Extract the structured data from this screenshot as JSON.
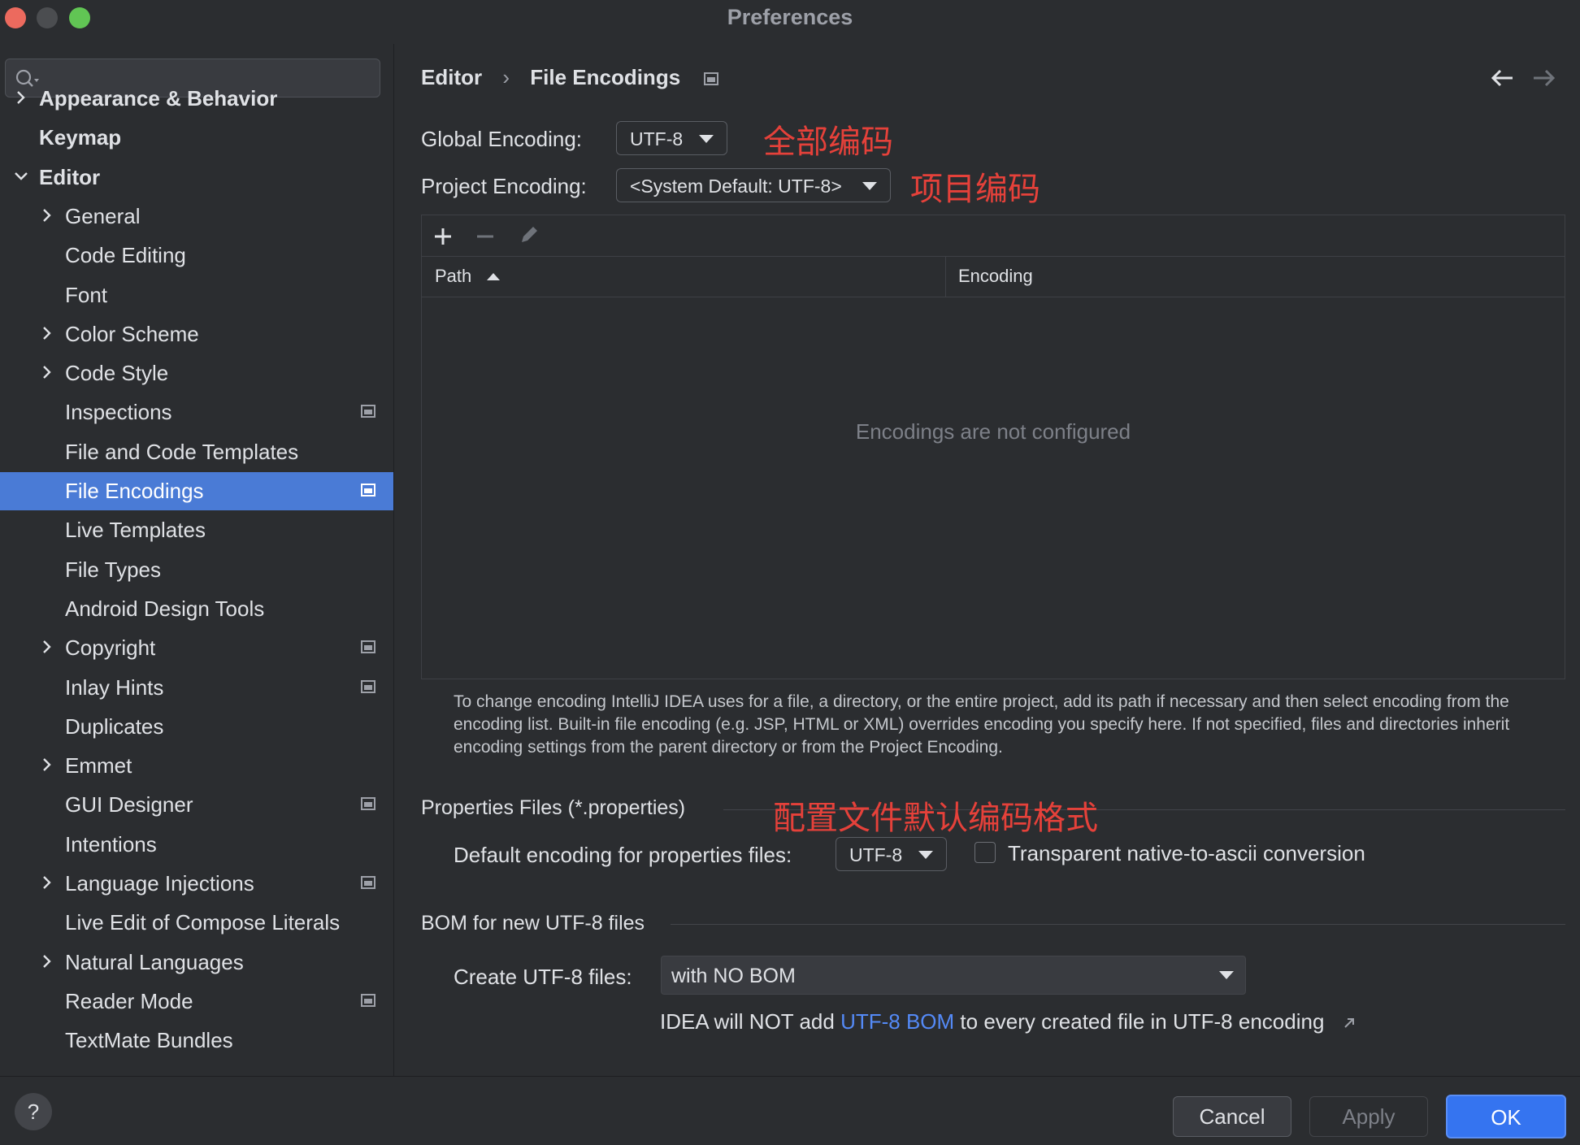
{
  "window": {
    "title": "Preferences",
    "traffic_colors": {
      "close": "#ec6a5e",
      "minimize": "#4b4d50",
      "maximize": "#61c554"
    }
  },
  "sidebar": {
    "search_placeholder": "",
    "items": [
      {
        "label": "Appearance & Behavior",
        "level": 0,
        "chevron": "right",
        "bold": true,
        "project_icon": false,
        "selected": false
      },
      {
        "label": "Keymap",
        "level": 0,
        "chevron": "none",
        "bold": true,
        "project_icon": false,
        "selected": false
      },
      {
        "label": "Editor",
        "level": 0,
        "chevron": "down",
        "bold": true,
        "project_icon": false,
        "selected": false
      },
      {
        "label": "General",
        "level": 1,
        "chevron": "right",
        "bold": false,
        "project_icon": false,
        "selected": false
      },
      {
        "label": "Code Editing",
        "level": 1,
        "chevron": "none",
        "bold": false,
        "project_icon": false,
        "selected": false
      },
      {
        "label": "Font",
        "level": 1,
        "chevron": "none",
        "bold": false,
        "project_icon": false,
        "selected": false
      },
      {
        "label": "Color Scheme",
        "level": 1,
        "chevron": "right",
        "bold": false,
        "project_icon": false,
        "selected": false
      },
      {
        "label": "Code Style",
        "level": 1,
        "chevron": "right",
        "bold": false,
        "project_icon": false,
        "selected": false
      },
      {
        "label": "Inspections",
        "level": 1,
        "chevron": "none",
        "bold": false,
        "project_icon": true,
        "selected": false
      },
      {
        "label": "File and Code Templates",
        "level": 1,
        "chevron": "none",
        "bold": false,
        "project_icon": false,
        "selected": false
      },
      {
        "label": "File Encodings",
        "level": 1,
        "chevron": "none",
        "bold": false,
        "project_icon": true,
        "selected": true
      },
      {
        "label": "Live Templates",
        "level": 1,
        "chevron": "none",
        "bold": false,
        "project_icon": false,
        "selected": false
      },
      {
        "label": "File Types",
        "level": 1,
        "chevron": "none",
        "bold": false,
        "project_icon": false,
        "selected": false
      },
      {
        "label": "Android Design Tools",
        "level": 1,
        "chevron": "none",
        "bold": false,
        "project_icon": false,
        "selected": false
      },
      {
        "label": "Copyright",
        "level": 1,
        "chevron": "right",
        "bold": false,
        "project_icon": true,
        "selected": false
      },
      {
        "label": "Inlay Hints",
        "level": 1,
        "chevron": "none",
        "bold": false,
        "project_icon": true,
        "selected": false
      },
      {
        "label": "Duplicates",
        "level": 1,
        "chevron": "none",
        "bold": false,
        "project_icon": false,
        "selected": false
      },
      {
        "label": "Emmet",
        "level": 1,
        "chevron": "right",
        "bold": false,
        "project_icon": false,
        "selected": false
      },
      {
        "label": "GUI Designer",
        "level": 1,
        "chevron": "none",
        "bold": false,
        "project_icon": true,
        "selected": false
      },
      {
        "label": "Intentions",
        "level": 1,
        "chevron": "none",
        "bold": false,
        "project_icon": false,
        "selected": false
      },
      {
        "label": "Language Injections",
        "level": 1,
        "chevron": "right",
        "bold": false,
        "project_icon": true,
        "selected": false
      },
      {
        "label": "Live Edit of Compose Literals",
        "level": 1,
        "chevron": "none",
        "bold": false,
        "project_icon": false,
        "selected": false
      },
      {
        "label": "Natural Languages",
        "level": 1,
        "chevron": "right",
        "bold": false,
        "project_icon": false,
        "selected": false
      },
      {
        "label": "Reader Mode",
        "level": 1,
        "chevron": "none",
        "bold": false,
        "project_icon": true,
        "selected": false
      },
      {
        "label": "TextMate Bundles",
        "level": 1,
        "chevron": "none",
        "bold": false,
        "project_icon": false,
        "selected": false
      }
    ]
  },
  "content": {
    "breadcrumb": {
      "parent": "Editor",
      "separator": "›",
      "current": "File Encodings"
    },
    "global_encoding": {
      "label": "Global Encoding:",
      "value": "UTF-8",
      "annotation": "全部编码"
    },
    "project_encoding": {
      "label": "Project Encoding:",
      "value": "<System Default: UTF-8>",
      "annotation": "项目编码"
    },
    "table": {
      "toolbar": [
        "add-icon",
        "remove-icon",
        "edit-icon"
      ],
      "columns": [
        "Path",
        "Encoding"
      ],
      "sort_column": "Path",
      "empty_text": "Encodings are not configured"
    },
    "help_text": "To change encoding IntelliJ IDEA uses for a file, a directory, or the entire project, add its path if necessary and then select encoding from the encoding list. Built-in file encoding (e.g. JSP, HTML or XML) overrides encoding you specify here. If not specified, files and directories inherit encoding settings from the parent directory or from the Project Encoding.",
    "properties": {
      "section_title": "Properties Files (*.properties)",
      "annotation": "配置文件默认编码格式",
      "default_label": "Default encoding for properties files:",
      "default_value": "UTF-8",
      "native_to_ascii_label": "Transparent native-to-ascii conversion",
      "native_to_ascii_checked": false
    },
    "bom": {
      "section_title": "BOM for new UTF-8 files",
      "create_label": "Create UTF-8 files:",
      "create_value": "with NO BOM",
      "note_prefix": "IDEA will NOT add",
      "note_link": "UTF-8 BOM",
      "note_suffix": "to every created file in UTF-8 encoding"
    }
  },
  "footer": {
    "help_label": "?",
    "cancel_label": "Cancel",
    "apply_label": "Apply",
    "ok_label": "OK"
  },
  "colors": {
    "accent": "#3574f0",
    "selection": "#4a7bd6",
    "annotation": "#e5413a",
    "link": "#548af7"
  }
}
